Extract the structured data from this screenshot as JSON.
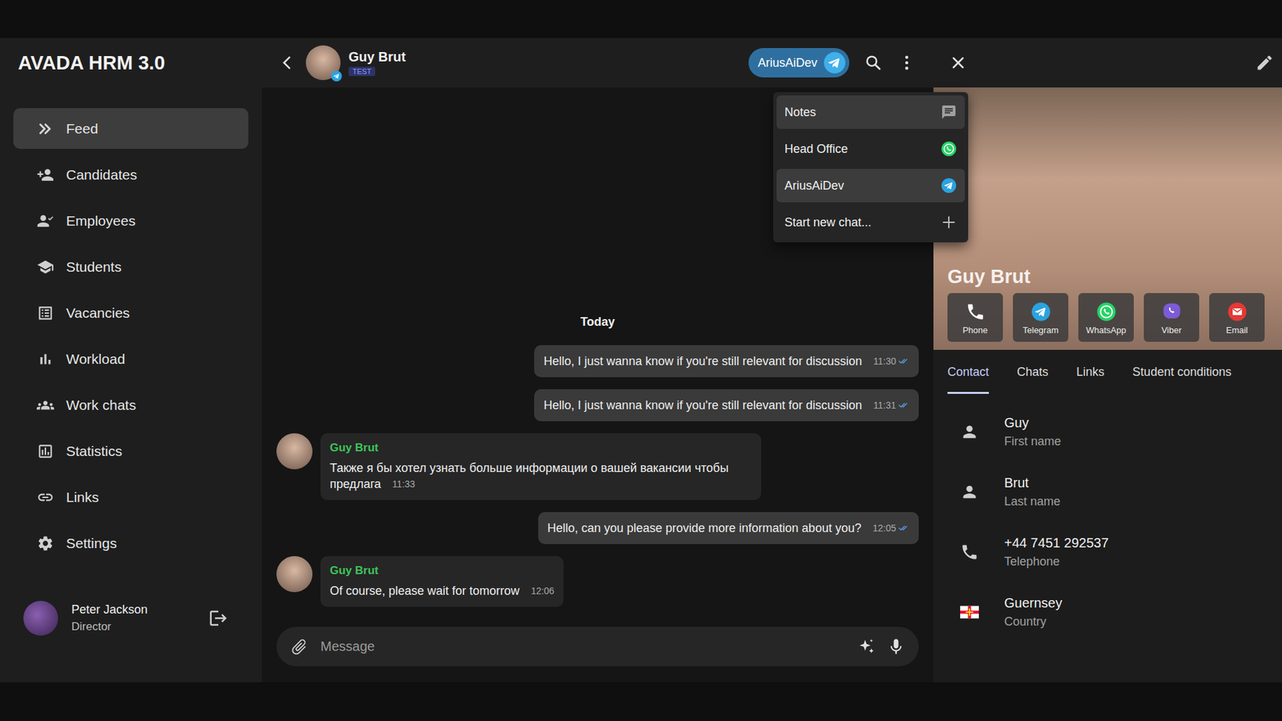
{
  "app": {
    "title": "AVADA HRM 3.0"
  },
  "sidebar": {
    "items": [
      {
        "label": "Feed",
        "selected": true
      },
      {
        "label": "Candidates",
        "selected": false
      },
      {
        "label": "Employees",
        "selected": false
      },
      {
        "label": "Students",
        "selected": false
      },
      {
        "label": "Vacancies",
        "selected": false
      },
      {
        "label": "Workload",
        "selected": false
      },
      {
        "label": "Work chats",
        "selected": false
      },
      {
        "label": "Statistics",
        "selected": false
      },
      {
        "label": "Links",
        "selected": false
      },
      {
        "label": "Settings",
        "selected": false
      }
    ],
    "user": {
      "name": "Peter Jackson",
      "role": "Director"
    }
  },
  "chat": {
    "contact_name": "Guy Brut",
    "badge": "TEST",
    "account": "AriusAiDev",
    "date_divider": "Today",
    "messages": [
      {
        "kind": "outgoing",
        "text": "Hello, I just wanna know if you're still relevant for discussion",
        "time": "11:30",
        "read": true
      },
      {
        "kind": "outgoing",
        "text": "Hello, I just wanna know if you're still relevant for discussion",
        "time": "11:31",
        "read": true
      },
      {
        "kind": "incoming",
        "sender": "Guy Brut",
        "text": "Также я бы хотел узнать больше информации о вашей вакансии чтобы предлага",
        "time": "11:33",
        "read": false
      },
      {
        "kind": "outgoing",
        "text": "Hello, can you please provide more information about you?",
        "time": "12:05",
        "read": true
      },
      {
        "kind": "incoming",
        "sender": "Guy Brut",
        "text": "Of course, please wait for tomorrow",
        "time": "12:06",
        "read": false
      }
    ],
    "input_placeholder": "Message"
  },
  "account_menu": {
    "items": [
      {
        "label": "Notes",
        "kind": "notes",
        "color": "#9e9e9e",
        "hovered": true,
        "selected": false
      },
      {
        "label": "Head Office",
        "kind": "whatsapp",
        "color": "#25d366",
        "hovered": false,
        "selected": false
      },
      {
        "label": "AriusAiDev",
        "kind": "telegram",
        "color": "#2aa3e0",
        "hovered": false,
        "selected": true
      },
      {
        "label": "Start new chat...",
        "kind": "add",
        "color": "#bdbdbd",
        "hovered": false,
        "selected": false
      }
    ]
  },
  "profile": {
    "name": "Guy Brut",
    "actions": [
      {
        "label": "Phone",
        "kind": "phone",
        "color": "#ffffff"
      },
      {
        "label": "Telegram",
        "kind": "telegram",
        "color": "#2aa3e0"
      },
      {
        "label": "WhatsApp",
        "kind": "whatsapp",
        "color": "#25d366"
      },
      {
        "label": "Viber",
        "kind": "viber",
        "color": "#7d5bd6"
      },
      {
        "label": "Email",
        "kind": "email",
        "color": "#e53935"
      }
    ],
    "tabs": [
      {
        "label": "Contact",
        "selected": true
      },
      {
        "label": "Chats",
        "selected": false
      },
      {
        "label": "Links",
        "selected": false
      },
      {
        "label": "Student conditions",
        "selected": false
      }
    ],
    "fields": [
      {
        "value": "Guy",
        "label": "First name",
        "kind": "person"
      },
      {
        "value": "Brut",
        "label": "Last name",
        "kind": "person"
      },
      {
        "value": "+44 7451 292537",
        "label": "Telephone",
        "kind": "phone"
      },
      {
        "value": "Guernsey",
        "label": "Country",
        "kind": "flag"
      }
    ]
  }
}
